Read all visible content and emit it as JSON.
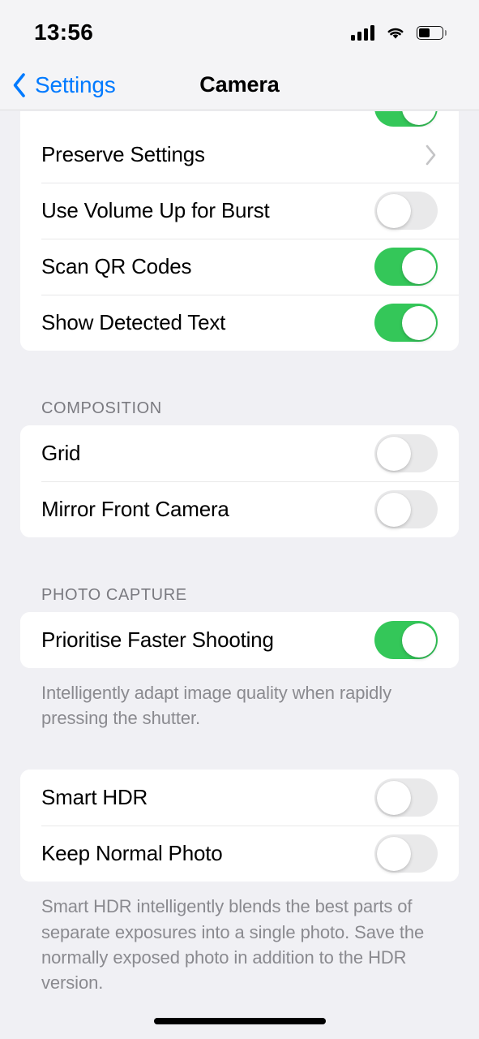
{
  "status_bar": {
    "time": "13:56",
    "cellular_icon": "cellular-bars-icon",
    "wifi_icon": "wifi-icon",
    "battery_icon": "battery-icon",
    "battery_level_percent": 52
  },
  "nav_bar": {
    "back_label": "Settings",
    "back_icon": "chevron-left-icon",
    "title": "Camera",
    "accent_color": "#007AFF"
  },
  "colors": {
    "page_background": "#F0F0F4",
    "card_background": "#FFFFFF",
    "switch_on": "#34C759",
    "switch_off": "#E9E9EA",
    "separator": "#E8E8E9",
    "secondary_text": "#8A8A8F",
    "header_text": "#7A7A80",
    "chevron": "#C4C4C6"
  },
  "sections": [
    {
      "id": "general",
      "header": "",
      "footer": "",
      "clipped_top": true,
      "rows": [
        {
          "label": "",
          "control": "switch",
          "value": "on",
          "clipped": true
        },
        {
          "label": "Preserve Settings",
          "control": "disclosure",
          "value": ""
        },
        {
          "label": "Use Volume Up for Burst",
          "control": "switch",
          "value": "off"
        },
        {
          "label": "Scan QR Codes",
          "control": "switch",
          "value": "on"
        },
        {
          "label": "Show Detected Text",
          "control": "switch",
          "value": "on"
        }
      ]
    },
    {
      "id": "composition",
      "header": "COMPOSITION",
      "footer": "",
      "clipped_top": false,
      "rows": [
        {
          "label": "Grid",
          "control": "switch",
          "value": "off"
        },
        {
          "label": "Mirror Front Camera",
          "control": "switch",
          "value": "off"
        }
      ]
    },
    {
      "id": "photo-capture",
      "header": "PHOTO CAPTURE",
      "footer": "Intelligently adapt image quality when rapidly pressing the shutter.",
      "clipped_top": false,
      "rows": [
        {
          "label": "Prioritise Faster Shooting",
          "control": "switch",
          "value": "on"
        }
      ]
    },
    {
      "id": "smart-hdr",
      "header": "",
      "footer": "Smart HDR intelligently blends the best parts of separate exposures into a single photo. Save the normally exposed photo in addition to the HDR version.",
      "clipped_top": false,
      "rows": [
        {
          "label": "Smart HDR",
          "control": "switch",
          "value": "off"
        },
        {
          "label": "Keep Normal Photo",
          "control": "switch",
          "value": "off"
        }
      ]
    }
  ],
  "home_indicator": "home-indicator"
}
